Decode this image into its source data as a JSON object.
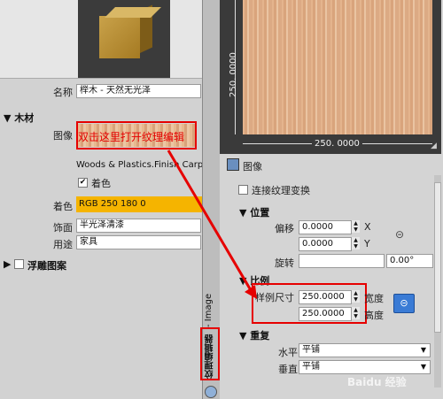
{
  "material": {
    "name_label": "名称",
    "name_value": "榉木 - 天然无光泽",
    "section_wood": "木材",
    "image_label": "图像",
    "callout_text": "双击这里打开纹理编辑",
    "image_file": "Woods & Plastics.Finish Carp",
    "tint_checkbox_label": "着色",
    "tint_label": "着色",
    "tint_value": "RGB 250 180 0",
    "finish_label": "饰面",
    "finish_value": "半光泽清漆",
    "use_label": "用途",
    "use_value": "家具",
    "relief_label": "浮雕图案"
  },
  "editor_tab": {
    "label_red": "纹理编辑器",
    "label_rest": " - Image"
  },
  "texture": {
    "dim_vertical": "250. 0000",
    "dim_horizontal": "250. 0000",
    "image_label": "图像",
    "link_transforms": "连接纹理变换",
    "section_position": "位置",
    "offset_label": "偏移",
    "offset_x": "0.0000",
    "offset_y": "0.0000",
    "x_label": "X",
    "y_label": "Y",
    "rotate_label": "旋转",
    "rotate_value": "0.00°",
    "section_scale": "比例",
    "sample_size_label": "样例尺寸",
    "width_value": "250.0000",
    "height_value": "250.0000",
    "width_label": "宽度",
    "height_label": "高度",
    "section_repeat": "重复",
    "horizontal_label": "水平",
    "horizontal_value": "平铺",
    "vertical_label": "垂直",
    "vertical_value": "平铺"
  },
  "colors": {
    "highlight_red": "#e60000",
    "tint_orange": "#f5b400",
    "link_blue": "#3a7bd5"
  },
  "watermark": "Baidu 经验"
}
